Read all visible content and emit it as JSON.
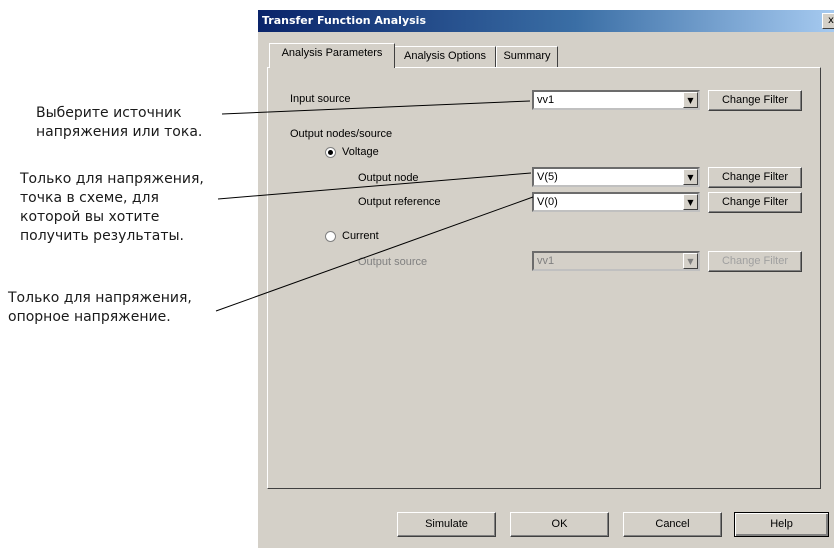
{
  "annotations": {
    "source_1": "Выберите источник",
    "source_2": "напряжения или тока.",
    "node_1": "Только для напряжения,",
    "node_2": "точка в схеме, для",
    "node_3": "которой вы хотите",
    "node_4": "получить результаты.",
    "ref_1": "Только для напряжения,",
    "ref_2": "опорное напряжение."
  },
  "dialog": {
    "title": "Transfer Function Analysis",
    "close_glyph": "x",
    "tabs": [
      "Analysis Parameters",
      "Analysis Options",
      "Summary"
    ],
    "input_source_label": "Input source",
    "input_source_value": "vv1",
    "output_group_label": "Output nodes/source",
    "voltage_label": "Voltage",
    "current_label": "Current",
    "output_node_label": "Output node",
    "output_node_value": "V(5)",
    "output_reference_label": "Output reference",
    "output_reference_value": "V(0)",
    "output_source_label": "Output source",
    "output_source_value": "vv1",
    "change_filter_label": "Change Filter",
    "arrow_glyph": "▼",
    "buttons": {
      "simulate": "Simulate",
      "ok": "OK",
      "cancel": "Cancel",
      "help": "Help"
    },
    "voltage_selected": true
  }
}
